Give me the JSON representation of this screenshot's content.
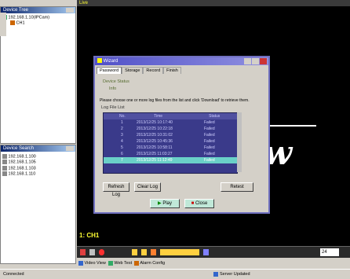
{
  "left_panel_top": {
    "title": "Device Tree",
    "items": [
      "192.168.1.10(IPCam)",
      "CH1"
    ]
  },
  "left_panel_bottom": {
    "title": "Device Search",
    "items": [
      "192.168.1.100",
      "192.168.1.105",
      "192.168.1.103",
      "192.168.1.110"
    ]
  },
  "viewer": {
    "title": "Live",
    "big_text": "w",
    "channel_label": "1: CH1"
  },
  "dialog": {
    "title": "Wizard",
    "tabs": [
      "Password",
      "Storage",
      "Record",
      "Finish"
    ],
    "section_label": "Device Status",
    "status_text": "Info",
    "instruction": "Please choose one or more log files from the list and click 'Download' to retrieve them.",
    "list_header": "Log File List",
    "columns": [
      "No.",
      "Time",
      "Status"
    ],
    "rows": [
      {
        "no": "1",
        "time": "2013/12/25 10:17:40",
        "status": "Failed"
      },
      {
        "no": "2",
        "time": "2013/12/25 10:22:18",
        "status": "Failed"
      },
      {
        "no": "3",
        "time": "2013/12/25 10:31:02",
        "status": "Failed"
      },
      {
        "no": "4",
        "time": "2013/12/25 10:45:36",
        "status": "Failed"
      },
      {
        "no": "5",
        "time": "2013/12/25 10:58:11",
        "status": "Failed"
      },
      {
        "no": "6",
        "time": "2013/12/25 11:03:27",
        "status": "Failed"
      },
      {
        "no": "7",
        "time": "2013/12/25 11:12:49",
        "status": "Failed"
      }
    ],
    "btn_refresh": "Refresh Log",
    "btn_clear": "Clear Log",
    "btn_retest": "Retest",
    "btn_play": "Play",
    "btn_close": "Close"
  },
  "bottom_tabs": [
    "Video View",
    "Web Test",
    "Alarm Config"
  ],
  "toolbar": {
    "zoom": "24"
  },
  "statusbar": {
    "left": "Connected",
    "right": "Server Updated"
  }
}
